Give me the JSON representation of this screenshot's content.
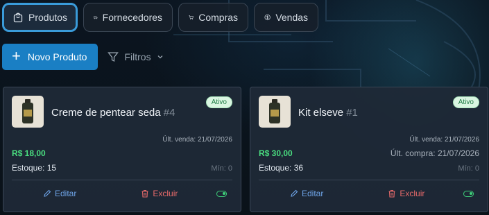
{
  "tabs": [
    {
      "label": "Produtos",
      "icon": "shopping-bag-icon",
      "active": true
    },
    {
      "label": "Fornecedores",
      "icon": "truck-icon",
      "active": false
    },
    {
      "label": "Compras",
      "icon": "cart-icon",
      "active": false
    },
    {
      "label": "Vendas",
      "icon": "dollar-circle-icon",
      "active": false
    }
  ],
  "toolbar": {
    "new_product_label": "Novo Produto",
    "filters_label": "Filtros"
  },
  "products": [
    {
      "name": "Creme de pentear seda",
      "id": "#4",
      "status": "Ativo",
      "meta_line": "Últ. venda: 21/07/2026",
      "price": "R$ 18,00",
      "price_right": "",
      "stock": "Estoque: 15",
      "min": "Mín: 0",
      "edit_label": "Editar",
      "delete_label": "Excluir"
    },
    {
      "name": "Kit elseve",
      "id": "#1",
      "status": "Ativo",
      "meta_line": "Últ. venda: 21/07/2026",
      "price": "R$ 30,00",
      "price_right": "Últ. compra: 21/07/2026",
      "stock": "Estoque: 36",
      "min": "Mín: 0",
      "edit_label": "Editar",
      "delete_label": "Excluir"
    }
  ],
  "colors": {
    "accent": "#1a7fc4",
    "active_tab_border": "#3a9bd9",
    "price_green": "#4ade80",
    "edit_blue": "#6ea4e8",
    "delete_red": "#e76a6a",
    "badge_bg": "#d9f5e1"
  }
}
